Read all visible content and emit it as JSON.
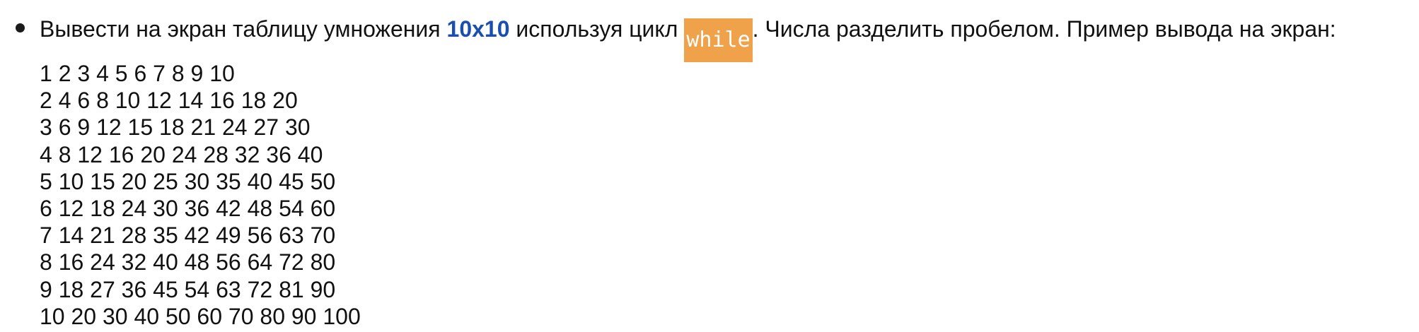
{
  "task": {
    "text_before": "Вывести на экран таблицу умножения ",
    "size_label": "10x10",
    "text_middle": " используя цикл ",
    "code_keyword": "while",
    "text_after": ". Числа разделить пробелом. Пример вывода на экран:"
  },
  "example_output": [
    "1 2 3 4 5 6 7 8 9 10",
    "2 4 6 8 10 12 14 16 18 20",
    "3 6 9 12 15 18 21 24 27 30",
    "4 8 12 16 20 24 28 32 36 40",
    "5 10 15 20 25 30 35 40 45 50",
    "6 12 18 24 30 36 42 48 54 60",
    "7 14 21 28 35 42 49 56 63 70",
    "8 16 24 32 40 48 56 64 72 80",
    "9 18 27 36 45 54 63 72 81 90",
    "10 20 30 40 50 60 70 80 90 100"
  ],
  "colors": {
    "accent_text": "#1a4fb0",
    "code_highlight_bg": "#f0a24b"
  }
}
